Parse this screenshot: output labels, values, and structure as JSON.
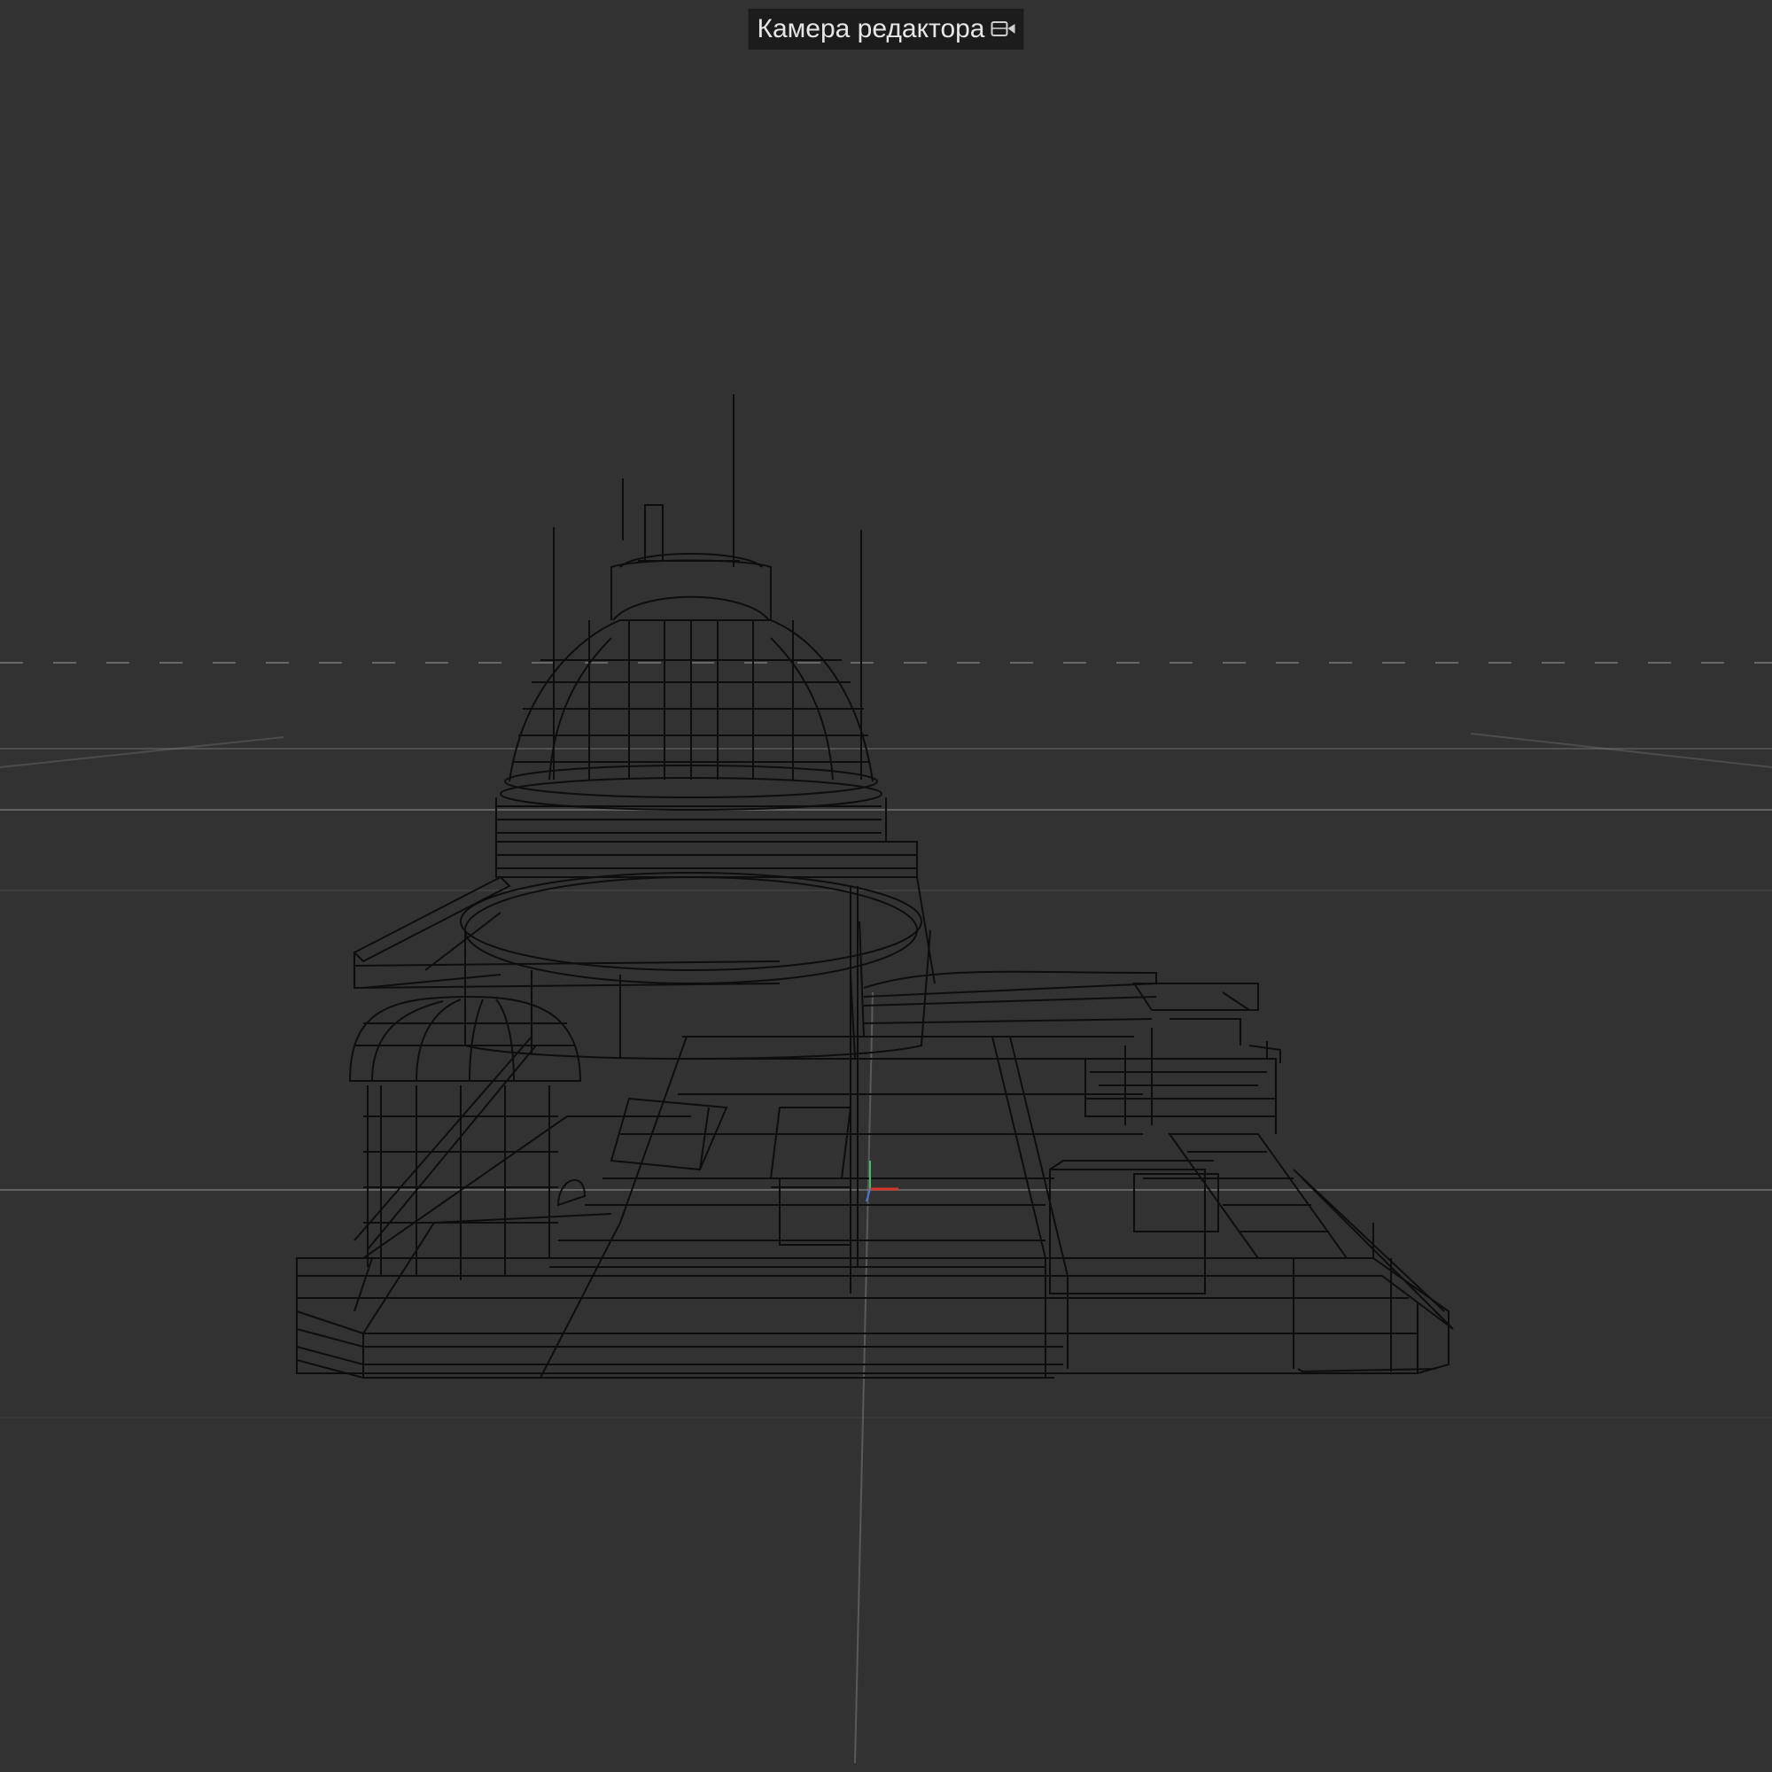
{
  "viewport": {
    "camera_label": "Камера редактора",
    "camera_icon": "camera-icon",
    "render_mode": "wireframe",
    "colors": {
      "background": "#323232",
      "wire": "#0d0d0d",
      "grid": "#8a8a8a",
      "axis_x": "#d0382b",
      "axis_y": "#3ec06a",
      "axis_z": "#4a7bd8"
    }
  }
}
